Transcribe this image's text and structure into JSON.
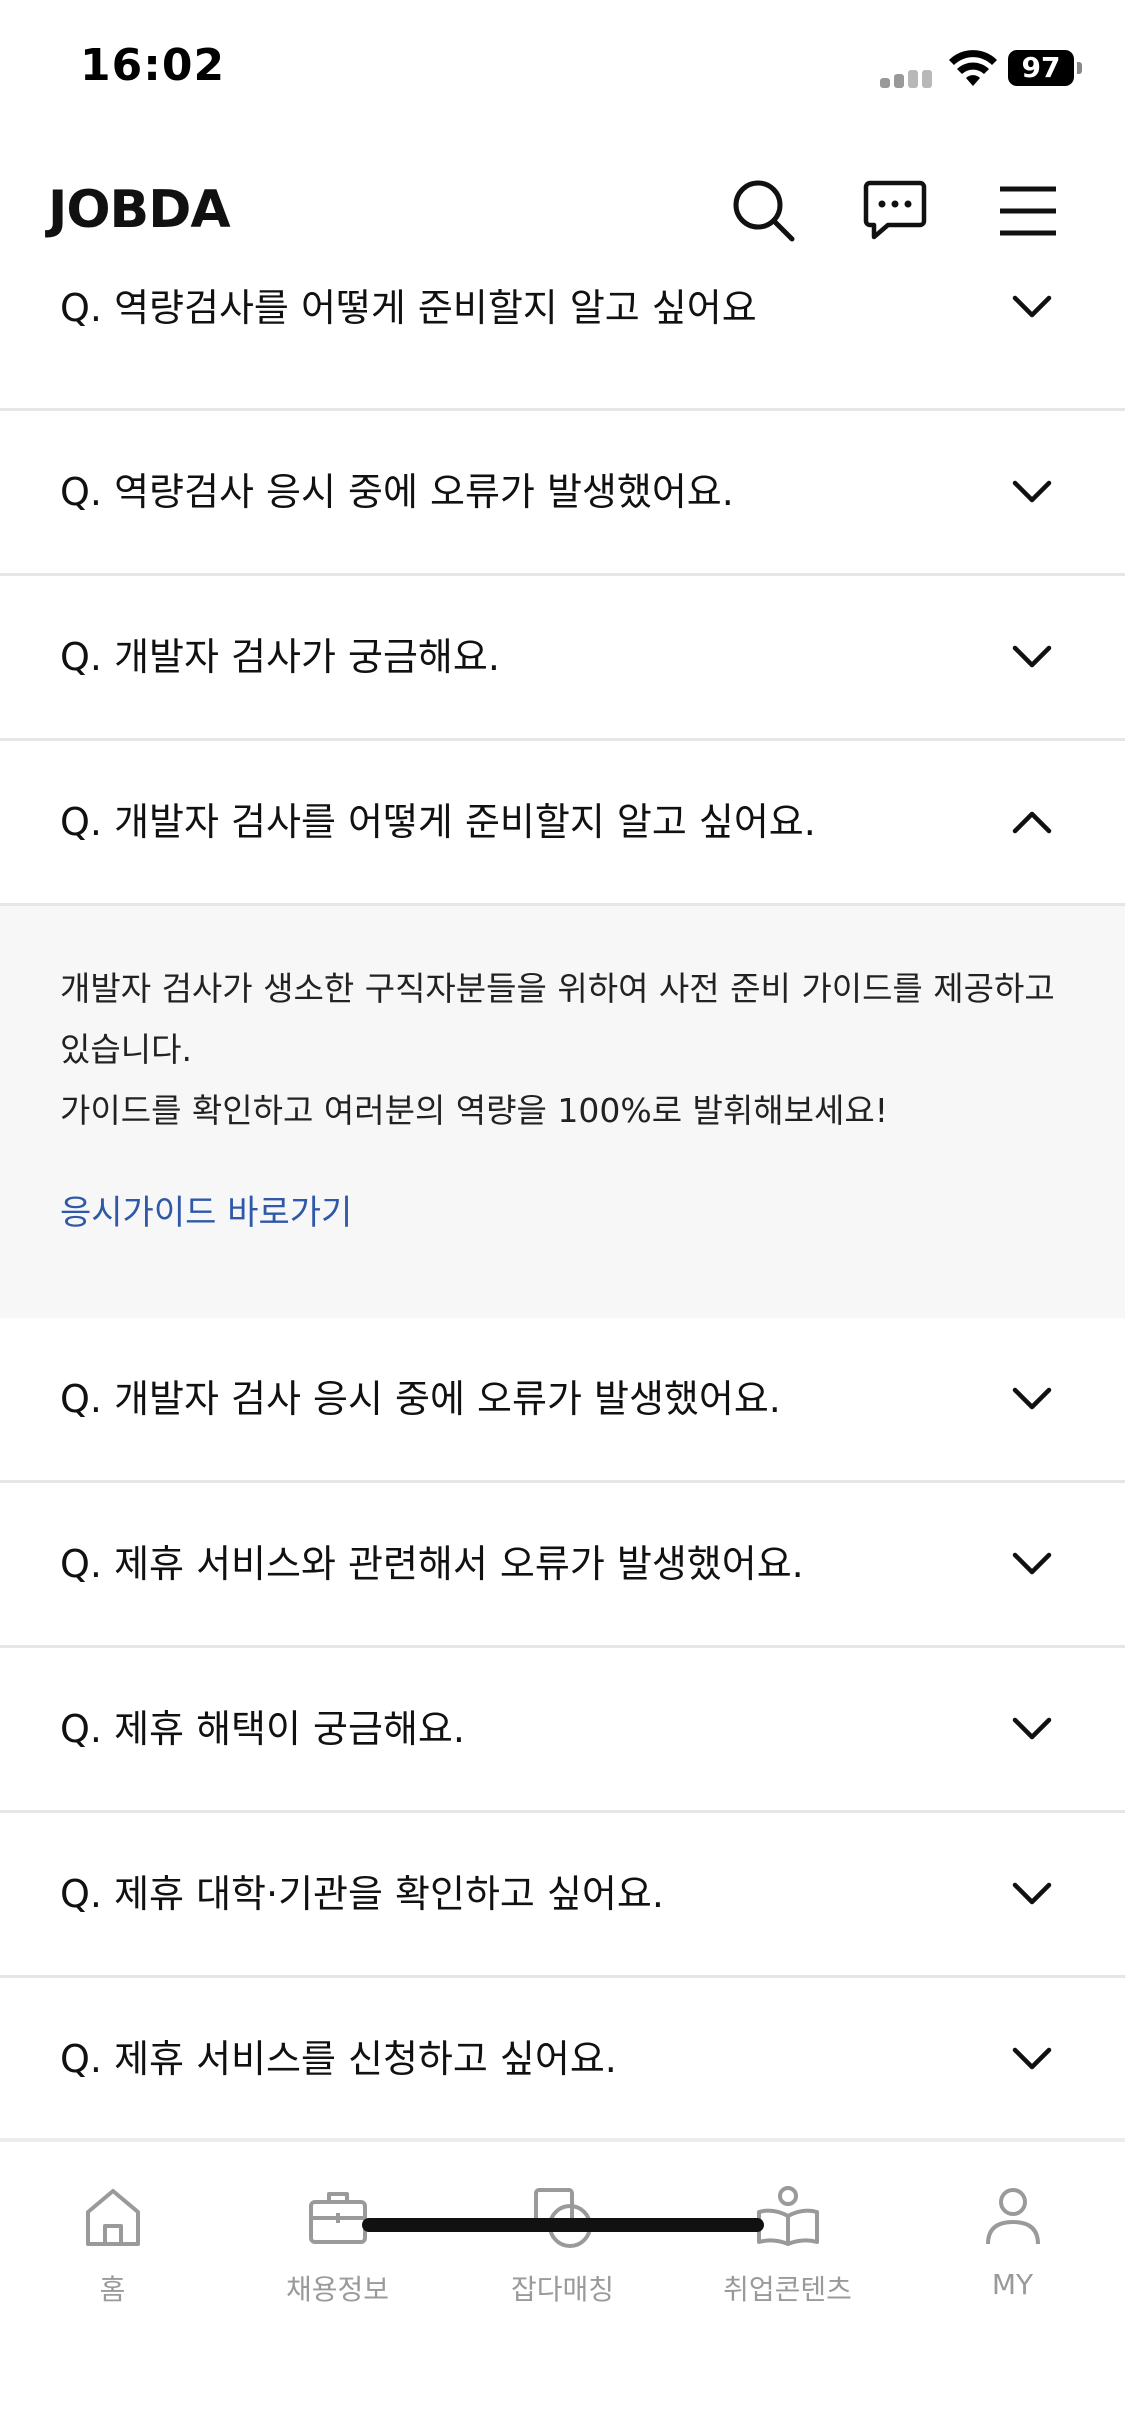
{
  "status": {
    "time": "16:02",
    "battery": "97"
  },
  "header": {
    "logo": "JOBDA"
  },
  "faq_top": [
    "Q. 역량검사를 어떻게 준비할지 알고 싶어요",
    "Q. 역량검사 응시 중에 오류가 발생했어요.",
    "Q. 개발자 검사가 궁금해요."
  ],
  "faq_expanded": {
    "question": "Q. 개발자 검사를 어떻게 준비할지 알고 싶어요.",
    "answer_lines": [
      "개발자 검사가 생소한 구직자분들을 위하여 사전 준비 가이드를 제공하고",
      "있습니다.",
      "가이드를 확인하고 여러분의 역량을 100%로 발휘해보세요!"
    ],
    "link": "응시가이드 바로가기"
  },
  "faq_bottom": [
    "Q. 개발자 검사 응시 중에 오류가 발생했어요.",
    "Q. 제휴 서비스와 관련해서 오류가 발생했어요.",
    "Q. 제휴 해택이 궁금해요.",
    "Q. 제휴 대학·기관을 확인하고 싶어요.",
    "Q. 제휴 서비스를 신청하고 싶어요."
  ],
  "tabs": [
    {
      "label": "홈",
      "icon": "home-icon"
    },
    {
      "label": "채용정보",
      "icon": "briefcase-icon"
    },
    {
      "label": "잡다매칭",
      "icon": "matching-icon"
    },
    {
      "label": "취업콘텐츠",
      "icon": "book-person-icon"
    },
    {
      "label": "MY",
      "icon": "person-icon"
    }
  ],
  "colors": {
    "link": "#2f58a8",
    "answer_bg": "#f7f7f7",
    "divider": "#e6e6e6",
    "tab_inactive": "#9a9a9a"
  }
}
